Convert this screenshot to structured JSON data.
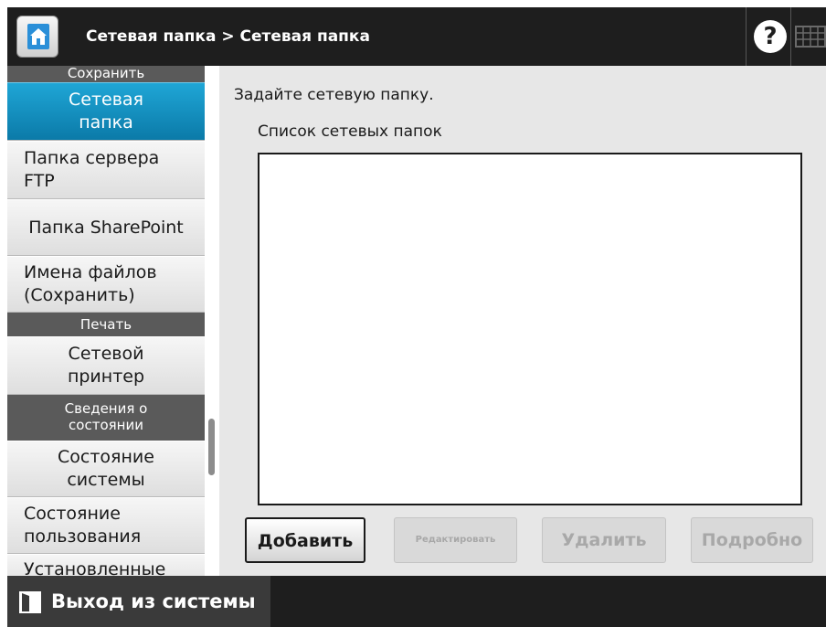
{
  "header": {
    "breadcrumb": "Сетевая папка > Сетевая папка",
    "home_icon": "home-icon",
    "help_icon": "help-icon",
    "help_glyph": "?",
    "keyboard_icon": "keyboard-icon"
  },
  "sidebar": {
    "sections": [
      {
        "header": "Сохранить",
        "items": [
          {
            "label": "Сетевая папка",
            "active": true
          },
          {
            "label": "Папка сервера FTP"
          },
          {
            "label": "Папка SharePoint"
          },
          {
            "label": "Имена файлов (Сохранить)"
          }
        ]
      },
      {
        "header": "Печать",
        "items": [
          {
            "label": "Сетевой принтер"
          }
        ]
      },
      {
        "header": "Сведения о состоянии",
        "items": [
          {
            "label": "Состояние системы"
          },
          {
            "label": "Состояние пользования"
          },
          {
            "label": "Установленные"
          }
        ]
      }
    ]
  },
  "main": {
    "instruction": "Задайте сетевую папку.",
    "list_label": "Список сетевых папок",
    "folders": [],
    "buttons": {
      "add": "Добавить",
      "edit": "Редактировать",
      "delete": "Удалить",
      "details": "Подробно"
    }
  },
  "footer": {
    "logout_label": "Выход из системы",
    "logout_icon": "logout-icon"
  },
  "colors": {
    "active_item": "#1593c7",
    "bar_background": "#1e1e1e",
    "section_header": "#5a5a5a"
  }
}
